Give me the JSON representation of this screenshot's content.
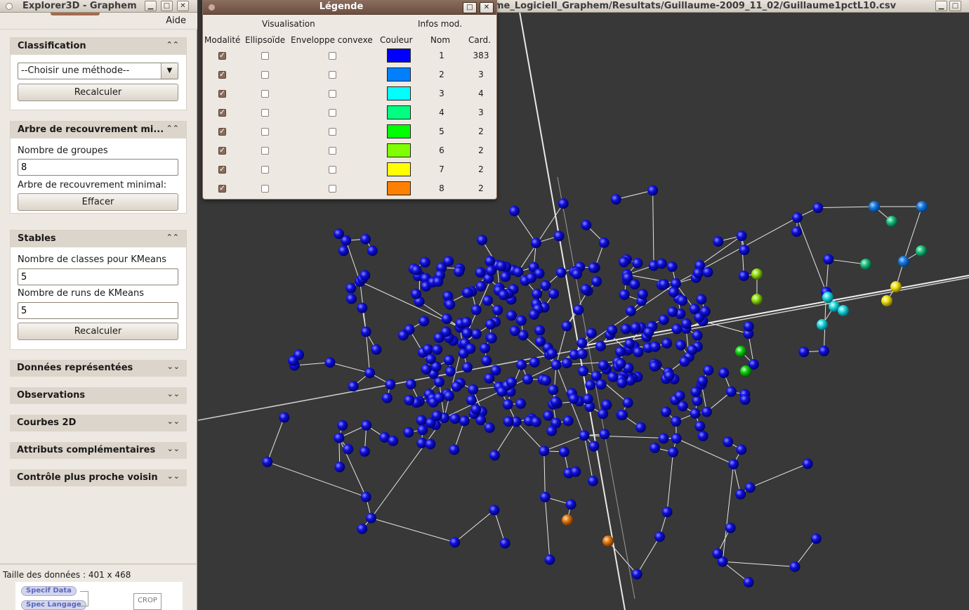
{
  "main_window": {
    "title_path": "me_Logiciell_Graphem/Resultats/Guillaume-2009_11_02/Guillaume1pctL10.csv"
  },
  "left_window": {
    "title": "Explorer3D - Graphem",
    "menu_aide": "Aide"
  },
  "classification": {
    "title": "Classification",
    "method_select": "--Choisir une méthode--",
    "recalc_button": "Recalculer"
  },
  "arbre": {
    "title": "Arbre de recouvrement mi...",
    "groupes_label": "Nombre de groupes",
    "groupes_value": "8",
    "arbre_label": "Arbre de recouvrement minimal:",
    "effacer_button": "Effacer"
  },
  "stables": {
    "title": "Stables",
    "kmeans_classes_label": "Nombre de classes pour KMeans",
    "kmeans_classes_value": "5",
    "kmeans_runs_label": "Nombre de runs de KMeans",
    "kmeans_runs_value": "5",
    "recalc_button": "Recalculer"
  },
  "collapsed_sections": [
    "Données représentées",
    "Observations",
    "Courbes 2D",
    "Attributs complémentaires",
    "Contrôle plus proche voisin"
  ],
  "data_size": "Taille des données : 401 x 468",
  "mini_diagram": {
    "pill1": "Specif Data",
    "pill2": "Spec Langage",
    "crop": "CROP"
  },
  "legend": {
    "title": "Légende",
    "group_visualisation": "Visualisation",
    "group_infos": "Infos mod.",
    "col_modalite": "Modalité",
    "col_ellipsoide": "Ellipsoïde",
    "col_enveloppe": "Enveloppe convexe",
    "col_couleur": "Couleur",
    "col_nom": "Nom",
    "col_card": "Card.",
    "rows": [
      {
        "nom": "1",
        "card": "383",
        "color": "#0000ff"
      },
      {
        "nom": "2",
        "card": "3",
        "color": "#0080ff"
      },
      {
        "nom": "3",
        "card": "4",
        "color": "#00ffff"
      },
      {
        "nom": "4",
        "card": "3",
        "color": "#00ff80"
      },
      {
        "nom": "5",
        "card": "2",
        "color": "#00ff00"
      },
      {
        "nom": "6",
        "card": "2",
        "color": "#80ff00"
      },
      {
        "nom": "7",
        "card": "2",
        "color": "#ffff00"
      },
      {
        "nom": "8",
        "card": "2",
        "color": "#ff8000"
      }
    ]
  },
  "colors": {
    "viewport_bg": "#383838",
    "legend_title": "#6b4f42",
    "panel_bg": "#ede8e1"
  }
}
